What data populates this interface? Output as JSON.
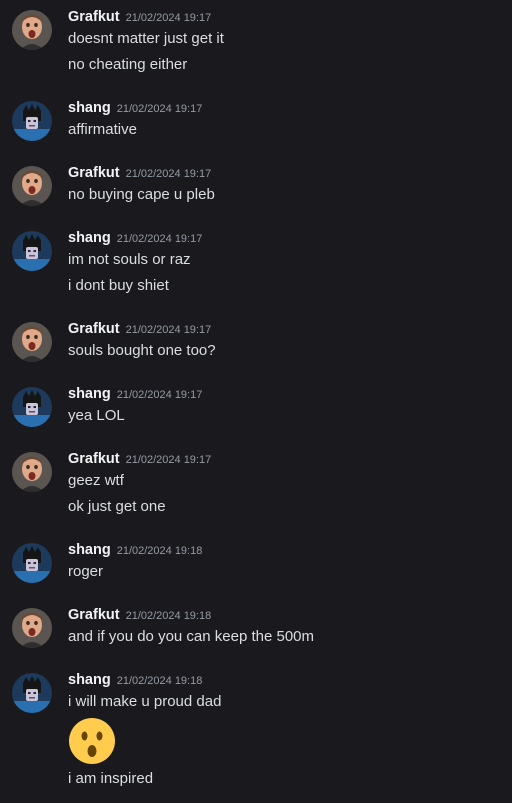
{
  "messages": [
    {
      "author": "Grafkut",
      "time": "21/02/2024 19:17",
      "lines": [
        "doesnt matter just get it",
        "no cheating either"
      ]
    },
    {
      "author": "shang",
      "time": "21/02/2024 19:17",
      "lines": [
        "affirmative"
      ]
    },
    {
      "author": "Grafkut",
      "time": "21/02/2024 19:17",
      "lines": [
        "no buying cape u pleb"
      ]
    },
    {
      "author": "shang",
      "time": "21/02/2024 19:17",
      "lines": [
        "im not souls or raz",
        "i dont buy shiet"
      ]
    },
    {
      "author": "Grafkut",
      "time": "21/02/2024 19:17",
      "lines": [
        "souls bought one too?"
      ]
    },
    {
      "author": "shang",
      "time": "21/02/2024 19:17",
      "lines": [
        "yea LOL"
      ]
    },
    {
      "author": "Grafkut",
      "time": "21/02/2024 19:17",
      "lines": [
        "geez wtf",
        "ok just get one"
      ]
    },
    {
      "author": "shang",
      "time": "21/02/2024 19:18",
      "lines": [
        "roger"
      ]
    },
    {
      "author": "Grafkut",
      "time": "21/02/2024 19:18",
      "lines": [
        "and if you do you can keep the 500m"
      ]
    },
    {
      "author": "shang",
      "time": "21/02/2024 19:18",
      "lines": [
        "i will make u proud dad",
        "i am inspired"
      ],
      "emoji": "hushed-face-emoji"
    }
  ],
  "colors": {
    "background": "#1a1a1e",
    "username": "#f2f3f5",
    "text": "#dbdee1",
    "timestamp": "#949ba4"
  }
}
